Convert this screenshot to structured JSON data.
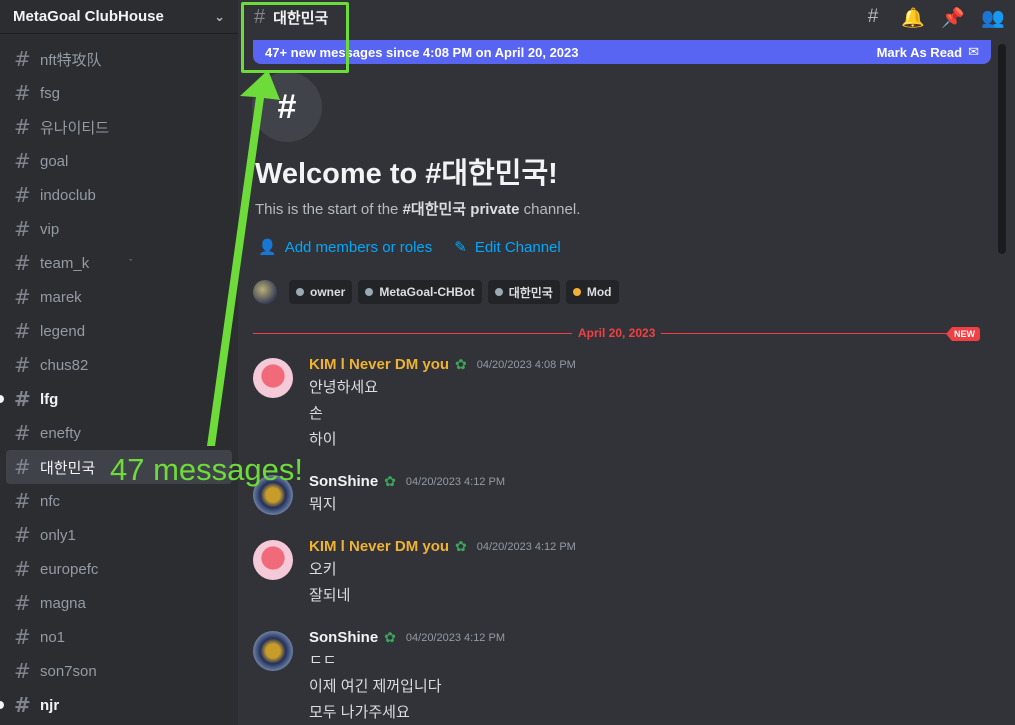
{
  "server": {
    "name": "MetaGoal ClubHouse"
  },
  "channels": [
    {
      "label": "nft特攻队",
      "state": "normal"
    },
    {
      "label": "fsg",
      "state": "normal"
    },
    {
      "label": "유나이티드",
      "state": "normal"
    },
    {
      "label": "goal",
      "state": "normal"
    },
    {
      "label": "indoclub",
      "state": "normal"
    },
    {
      "label": "vip",
      "state": "normal"
    },
    {
      "label": "team_k",
      "state": "normal"
    },
    {
      "label": "marek",
      "state": "normal"
    },
    {
      "label": "legend",
      "state": "normal"
    },
    {
      "label": "chus82",
      "state": "normal"
    },
    {
      "label": "lfg",
      "state": "unread"
    },
    {
      "label": "enefty",
      "state": "normal"
    },
    {
      "label": "대한민국",
      "state": "active"
    },
    {
      "label": "nfc",
      "state": "normal"
    },
    {
      "label": "only1",
      "state": "normal"
    },
    {
      "label": "europefc",
      "state": "normal"
    },
    {
      "label": "magna",
      "state": "normal"
    },
    {
      "label": "no1",
      "state": "normal"
    },
    {
      "label": "son7son",
      "state": "normal"
    },
    {
      "label": "njr",
      "state": "unread"
    }
  ],
  "topbar": {
    "channel_name": "대한민국"
  },
  "new_messages_bar": {
    "text": "47+ new messages since 4:08 PM on April 20, 2023",
    "mark_as_read": "Mark As Read"
  },
  "welcome": {
    "title": "Welcome to #대한민국!",
    "sub_prefix": "This is the start of the ",
    "sub_channel": "#대한민국",
    "sub_private": "private",
    "sub_suffix": " channel.",
    "add_members": "Add members or roles",
    "edit_channel": "Edit Channel"
  },
  "roles": [
    {
      "name": "owner",
      "color": "#99aab5"
    },
    {
      "name": "MetaGoal-CHBot",
      "color": "#99aab5"
    },
    {
      "name": "대한민국",
      "color": "#99aab5"
    },
    {
      "name": "Mod",
      "color": "#f0b232"
    }
  ],
  "divider": {
    "date": "April 20, 2023",
    "new_tag": "NEW"
  },
  "messages": [
    {
      "author": "KIM l Never DM you",
      "time": "04/20/2023 4:08 PM",
      "lines": [
        "안녕하세요",
        "손",
        "하이"
      ]
    },
    {
      "author": "SonShine",
      "time": "04/20/2023 4:12 PM",
      "lines": [
        "뭐지"
      ]
    },
    {
      "author": "KIM l Never DM you",
      "time": "04/20/2023 4:12 PM",
      "lines": [
        "오키",
        "잘되네"
      ]
    },
    {
      "author": "SonShine",
      "time": "04/20/2023 4:12 PM",
      "lines": [
        "ㄷㄷ",
        "이제 여긴 제꺼입니다",
        "모두 나가주세요"
      ]
    }
  ],
  "annotation": {
    "text": "47 messages!"
  }
}
